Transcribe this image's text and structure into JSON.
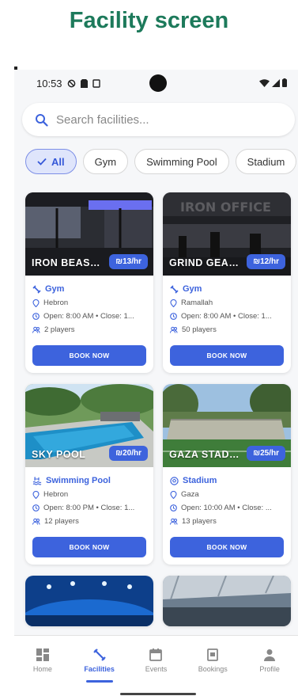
{
  "page_title": "Facility screen",
  "status_bar": {
    "time": "10:53"
  },
  "search": {
    "placeholder": "Search facilities..."
  },
  "filters": [
    {
      "label": "All",
      "active": true
    },
    {
      "label": "Gym"
    },
    {
      "label": "Swimming Pool"
    },
    {
      "label": "Stadium"
    }
  ],
  "facilities": [
    {
      "name": "IRON BEAST ...",
      "price": "₪13/hr",
      "category": "Gym",
      "location": "Hebron",
      "hours": "Open: 8:00 AM • Close: 1...",
      "players": "2 players",
      "book": "BOOK NOW"
    },
    {
      "name": "GRIND GEAR ...",
      "price": "₪12/hr",
      "category": "Gym",
      "location": "Ramallah",
      "hours": "Open: 8:00 AM • Close: 1...",
      "players": "50 players",
      "book": "BOOK NOW"
    },
    {
      "name": "SKY POOL",
      "price": "₪20/hr",
      "category": "Swimming Pool",
      "location": "Hebron",
      "hours": "Open: 8:00 PM • Close: 1...",
      "players": "12 players",
      "book": "BOOK NOW"
    },
    {
      "name": "GAZA STADIU...",
      "price": "₪25/hr",
      "category": "Stadium",
      "location": "Gaza",
      "hours": "Open: 10:00 AM • Close: ...",
      "players": "13 players",
      "book": "BOOK NOW"
    }
  ],
  "bottom_nav": [
    {
      "label": "Home"
    },
    {
      "label": "Facilities",
      "active": true
    },
    {
      "label": "Events"
    },
    {
      "label": "Bookings"
    },
    {
      "label": "Profile"
    }
  ],
  "colors": {
    "accent": "#3d63dd",
    "title": "#1d7a5b"
  }
}
